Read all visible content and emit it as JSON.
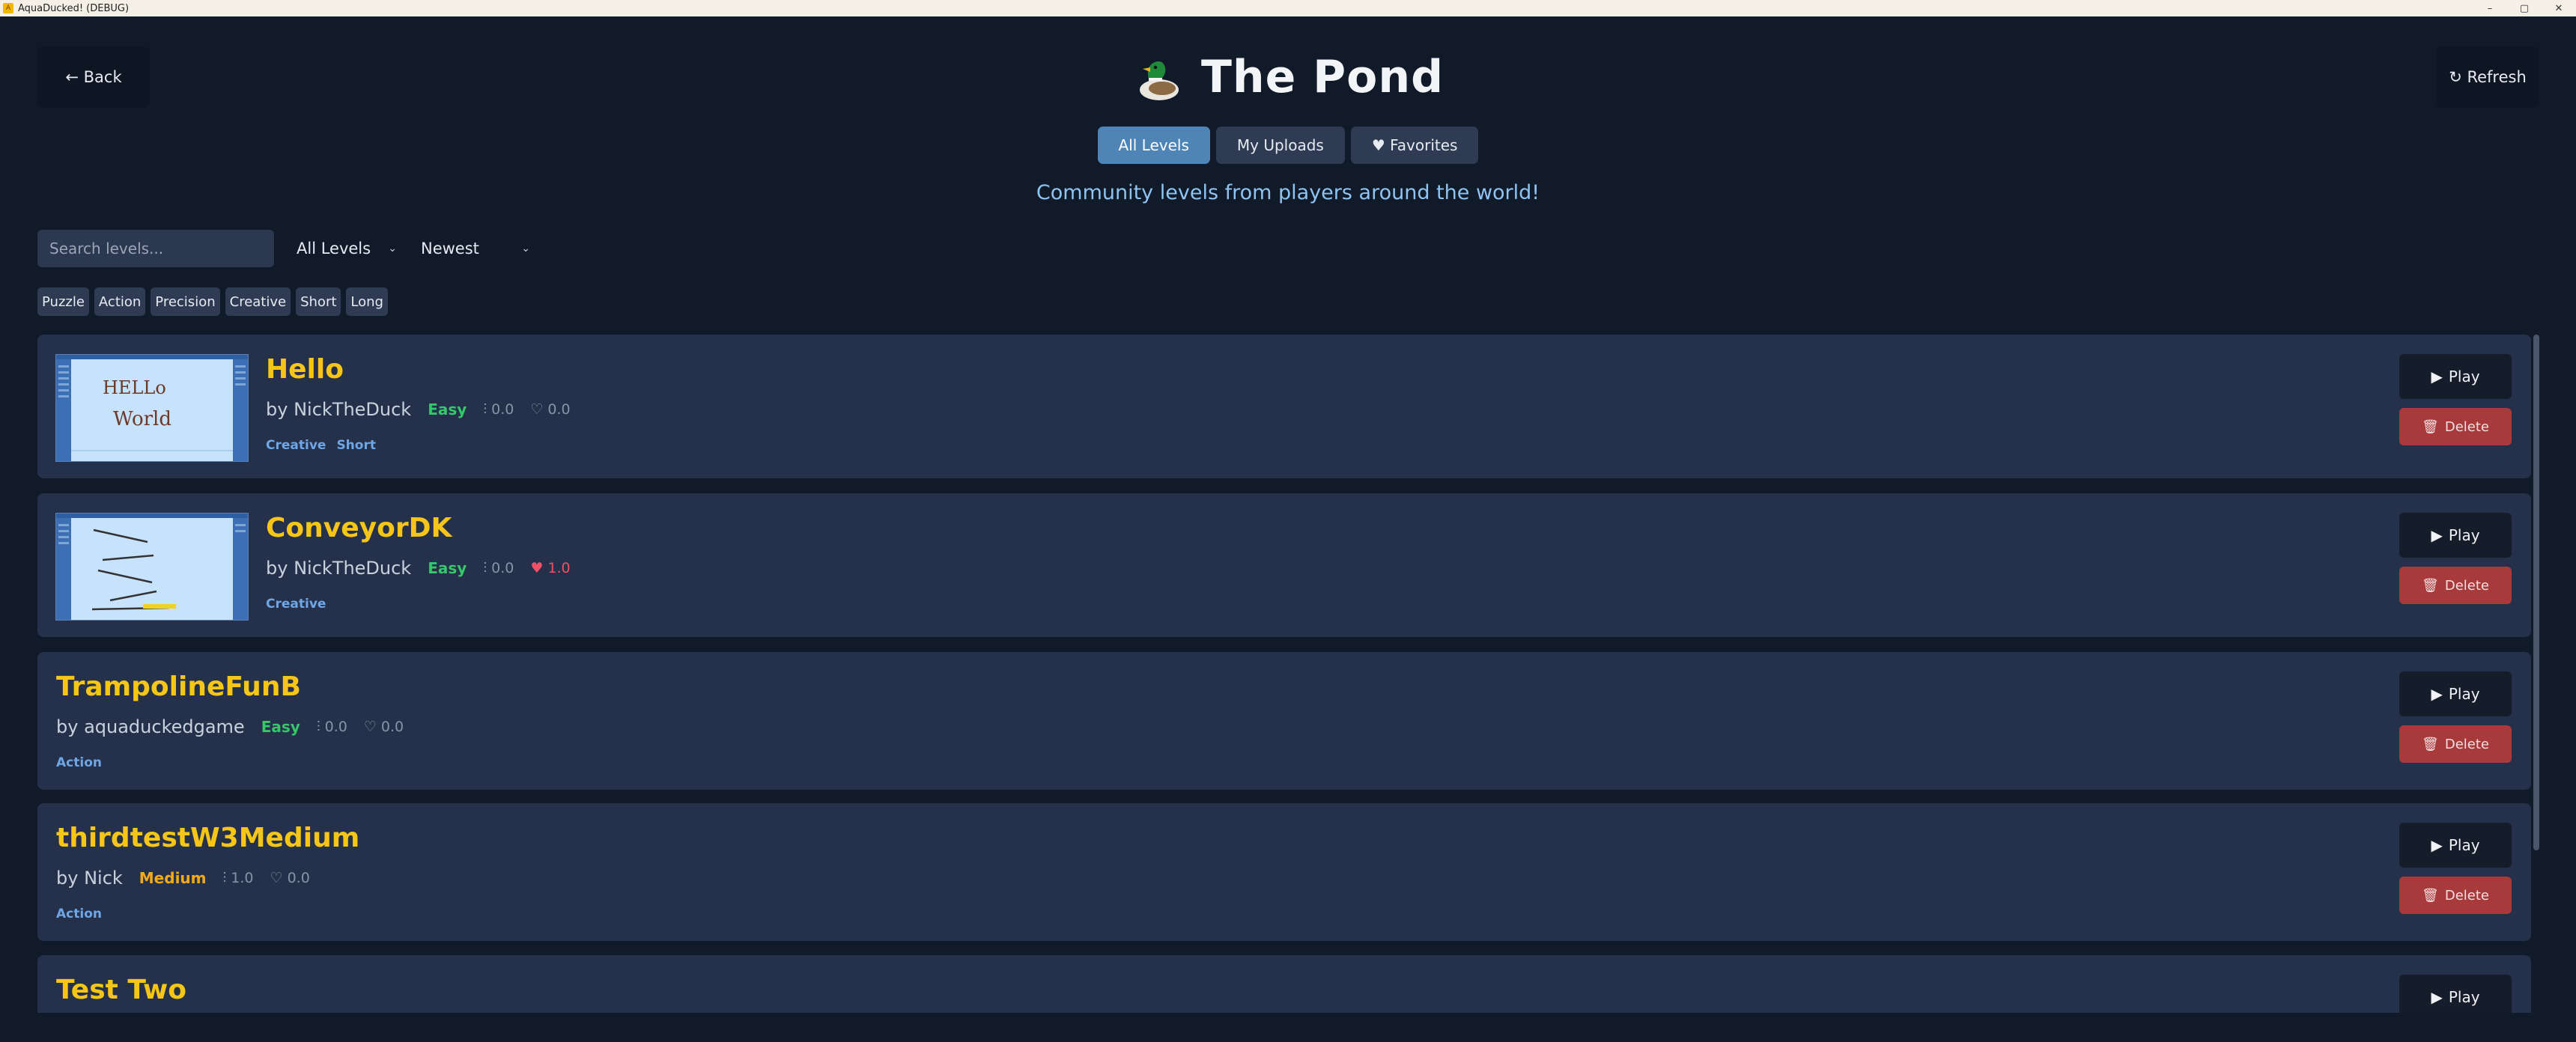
{
  "window": {
    "title": "AquaDucked! (DEBUG)",
    "controls": {
      "minimize": "–",
      "maximize": "▢",
      "close": "✕"
    }
  },
  "header": {
    "back_label": "← Back",
    "title": "The Pond",
    "refresh_label": "↻ Refresh"
  },
  "tabs": [
    {
      "label": "All Levels",
      "active": true
    },
    {
      "label": "My Uploads",
      "active": false
    },
    {
      "label": "♥ Favorites",
      "active": false
    }
  ],
  "subtitle": "Community levels from players around the world!",
  "filters": {
    "search_placeholder": "Search levels...",
    "level_filter": "All Levels",
    "sort": "Newest",
    "tags": [
      "Puzzle",
      "Action",
      "Precision",
      "Creative",
      "Short",
      "Long"
    ]
  },
  "levels": [
    {
      "title": "Hello",
      "author": "by NickTheDuck",
      "difficulty": "Easy",
      "plays": "⫶ 0.0",
      "likes": "♡ 0.0",
      "tags": [
        "Creative",
        "Short"
      ],
      "thumbnail": "hello-world-drawing",
      "liked": false
    },
    {
      "title": "ConveyorDK",
      "author": "by NickTheDuck",
      "difficulty": "Easy",
      "plays": "⫶ 0.0",
      "likes": "♥ 1.0",
      "tags": [
        "Creative"
      ],
      "thumbnail": "conveyor-lines",
      "liked": true
    },
    {
      "title": "TrampolineFunB",
      "author": "by aquaduckedgame",
      "difficulty": "Easy",
      "plays": "⫶ 0.0",
      "likes": "♡ 0.0",
      "tags": [
        "Action"
      ],
      "thumbnail": null,
      "liked": false
    },
    {
      "title": "thirdtestW3Medium",
      "author": "by Nick",
      "difficulty": "Medium",
      "plays": "⫶ 1.0",
      "likes": "♡ 0.0",
      "tags": [
        "Action"
      ],
      "thumbnail": null,
      "liked": false
    },
    {
      "title": "Test Two",
      "author": "",
      "difficulty": "",
      "plays": "",
      "likes": "",
      "tags": [],
      "thumbnail": null,
      "liked": false
    }
  ],
  "actions": {
    "play": "Play",
    "delete": "Delete"
  },
  "thumb_text": {
    "line1": "HELLo",
    "line2": "World"
  },
  "colors": {
    "background": "#111a29",
    "card": "#25314a",
    "title_yellow": "#f5c518",
    "easy": "#35c76a",
    "medium": "#f2a91a",
    "tab_active": "#4f84b6",
    "delete": "#a83a3c",
    "like_active": "#f04f65"
  }
}
